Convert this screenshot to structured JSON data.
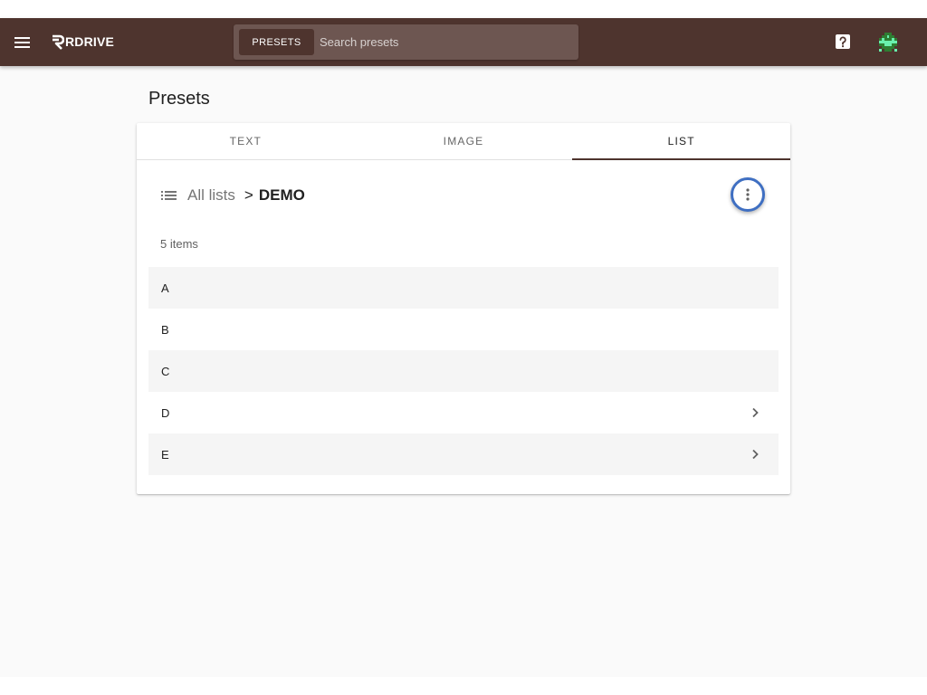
{
  "app": {
    "logo_text": "RDRIVE"
  },
  "search": {
    "chip_label": "PRESETS",
    "placeholder": "Search presets",
    "value": ""
  },
  "page": {
    "title": "Presets"
  },
  "tabs": [
    {
      "label": "TEXT",
      "active": false
    },
    {
      "label": "IMAGE",
      "active": false
    },
    {
      "label": "LIST",
      "active": true
    }
  ],
  "breadcrumb": {
    "root_label": "All lists",
    "separator": ">",
    "current": "DEMO"
  },
  "list": {
    "count_label": "5 items",
    "items": [
      {
        "label": "A",
        "has_children": false
      },
      {
        "label": "B",
        "has_children": false
      },
      {
        "label": "C",
        "has_children": false
      },
      {
        "label": "D",
        "has_children": true
      },
      {
        "label": "E",
        "has_children": true
      }
    ]
  },
  "icons": {
    "menu": "menu-icon",
    "help": "help-icon",
    "list": "list-icon",
    "more": "more-vert-icon",
    "chevron": "chevron-right-icon"
  },
  "colors": {
    "appbar": "#4e342e",
    "search_bg": "#6d5651",
    "active_tab_indicator": "#4e342e",
    "focus_ring": "#3f6fc2",
    "row_alt": "#f5f5f5"
  }
}
